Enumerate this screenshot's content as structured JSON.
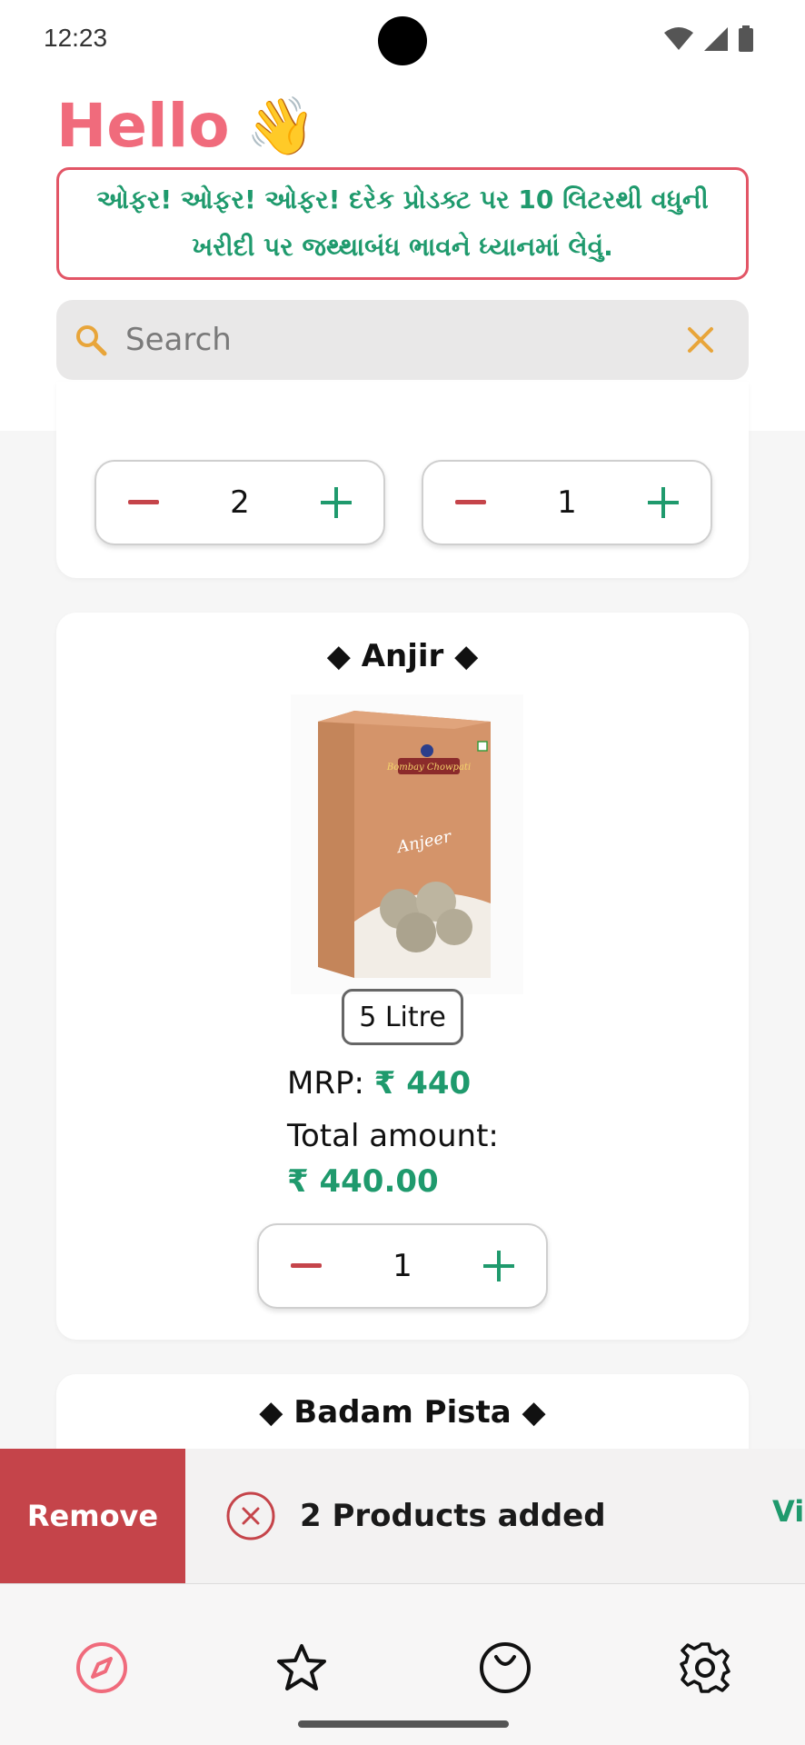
{
  "status_bar": {
    "time": "12:23"
  },
  "header": {
    "greeting": "Hello",
    "wave_emoji": "👋",
    "offer_text": "ઓફર! ઓફર! ઓફર! દરેક પ્રોડક્ટ પર 10 લિટરથી વધુની ખરીદી પર જથ્થાબંધ ભાવને ધ્યાનમાં લેવું."
  },
  "search": {
    "placeholder": "Search",
    "value": ""
  },
  "top_card": {
    "stepper_left_qty": "2",
    "stepper_right_qty": "1"
  },
  "products": [
    {
      "name": "◆ Anjir ◆",
      "image_label": "Anjeer",
      "brand": "Bombay Chowpati",
      "size": "5 Litre",
      "mrp_label": "MRP:",
      "mrp_value": "₹ 440",
      "total_label": "Total amount:",
      "total_value": "₹ 440.00",
      "qty": "1"
    },
    {
      "name": "◆ Badam Pista ◆"
    }
  ],
  "snackbar": {
    "remove_label": "Remove",
    "message": "2 Products added",
    "action_label": "View"
  },
  "nav": [
    "explore-icon",
    "favorites-icon",
    "orders-icon",
    "settings-icon"
  ],
  "colors": {
    "accent_pink": "#f06b7c",
    "offer_border": "#e25566",
    "green": "#1f9a6d",
    "minus_red": "#c5444a",
    "remove_bg": "#c5444a"
  }
}
